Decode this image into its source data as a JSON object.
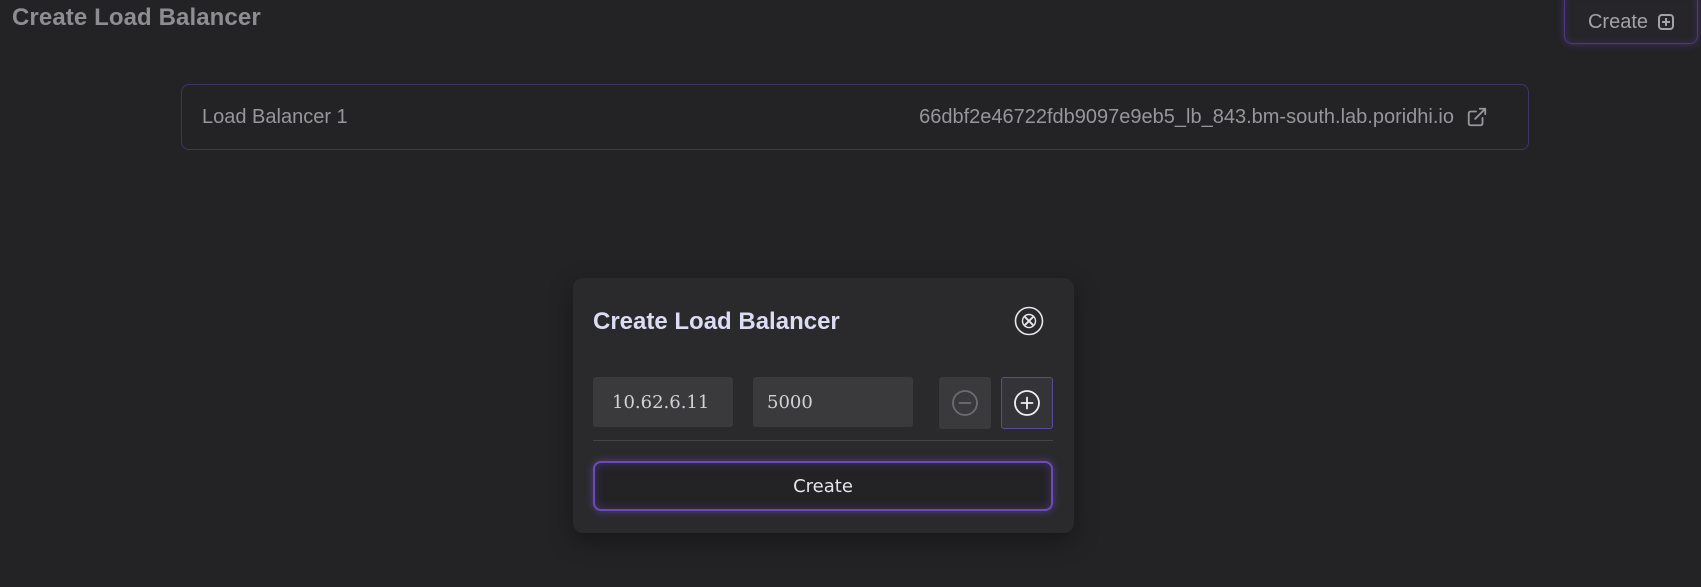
{
  "header": {
    "title": "Create Load Balancer",
    "create_label": "Create",
    "create_icon": "plus-square-icon"
  },
  "load_balancers": [
    {
      "name": "Load Balancer 1",
      "url": "66dbf2e46722fdb9097e9eb5_lb_843.bm-south.lab.poridhi.io",
      "link_icon": "external-link-icon"
    }
  ],
  "modal": {
    "title": "Create Load Balancer",
    "close_icon": "close-circle-icon",
    "ip_value": "10.62.6.11",
    "port_value": "5000",
    "remove_icon": "minus-circle-icon",
    "add_icon": "plus-circle-icon",
    "create_label": "Create"
  },
  "colors": {
    "background": "#232325",
    "modal_background": "#2a2a2c",
    "accent_purple": "#6a4bb8",
    "border_purple": "#3e3566",
    "input_background": "#3a3a3c"
  }
}
